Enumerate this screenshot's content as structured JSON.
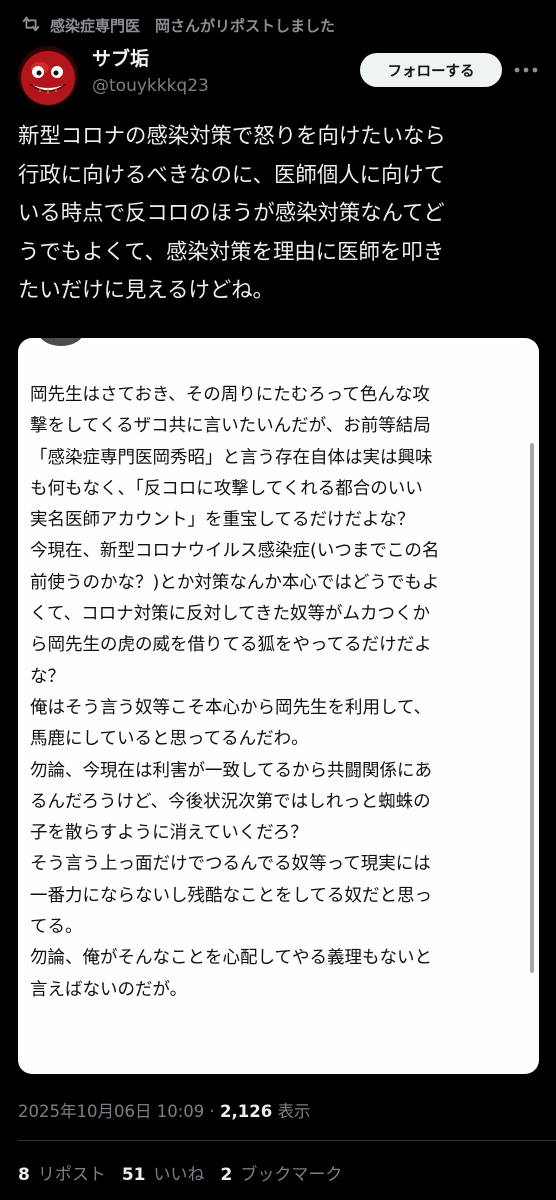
{
  "repost": {
    "label": "感染症専門医　岡さんがリポストしました",
    "icon": "repost-icon"
  },
  "author": {
    "name": "サブ垢",
    "handle": "@touykkkq23"
  },
  "actions": {
    "follow_label": "フォローする",
    "more_icon": "more-icon"
  },
  "post": {
    "lines": [
      "新型コロナの感染対策で怒りを向けたいなら",
      "行政に向けるべきなのに、医師個人に向けて",
      "いる時点で反コロのほうが感染対策なんてど",
      "うでもよくて、感染対策を理由に医師を叩き",
      "たいだけに見えるけどね。"
    ]
  },
  "image": {
    "lines": [
      "岡先生はさておき、その周りにたむろって色んな攻",
      "撃をしてくるザコ共に言いたいんだが、お前等結局",
      "「感染症専門医岡秀昭」と言う存在自体は実は興味",
      "も何もなく、「反コロに攻撃してくれる都合のいい",
      "実名医師アカウント」を重宝してるだけだよな？",
      "今現在、新型コロナウイルス感染症(いつまでこの名",
      "前使うのかな？)とか対策なんか本心ではどうでもよ",
      "くて、コロナ対策に反対してきた奴等がムカつくか",
      "ら岡先生の虎の威を借りてる狐をやってるだけだよ",
      "な？",
      "俺はそう言う奴等こそ本心から岡先生を利用して、",
      "馬鹿にしていると思ってるんだわ。",
      "勿論、今現在は利害が一致してるから共闘関係にあ",
      "るんだろうけど、今後状況次第ではしれっと蜘蛛の",
      "子を散らすように消えていくだろ？",
      "そう言う上っ面だけでつるんでる奴等って現実には",
      "一番力にならないし残酷なことをしてる奴だと思っ",
      "てる。",
      "勿論、俺がそんなことを心配してやる義理もないと",
      "言えばないのだが。"
    ]
  },
  "meta": {
    "timestamp": "2025年10月06日 10:09",
    "separator": "·",
    "views_count": "2,126",
    "views_label": "表示"
  },
  "stats": {
    "reposts_count": "8",
    "reposts_label": "リポスト",
    "likes_count": "51",
    "likes_label": "いいね",
    "bookmarks_count": "2",
    "bookmarks_label": "ブックマーク"
  },
  "colors": {
    "background": "#000000",
    "text": "#e7e9ea",
    "muted": "#7a7f84",
    "button": "#eff3f4"
  }
}
